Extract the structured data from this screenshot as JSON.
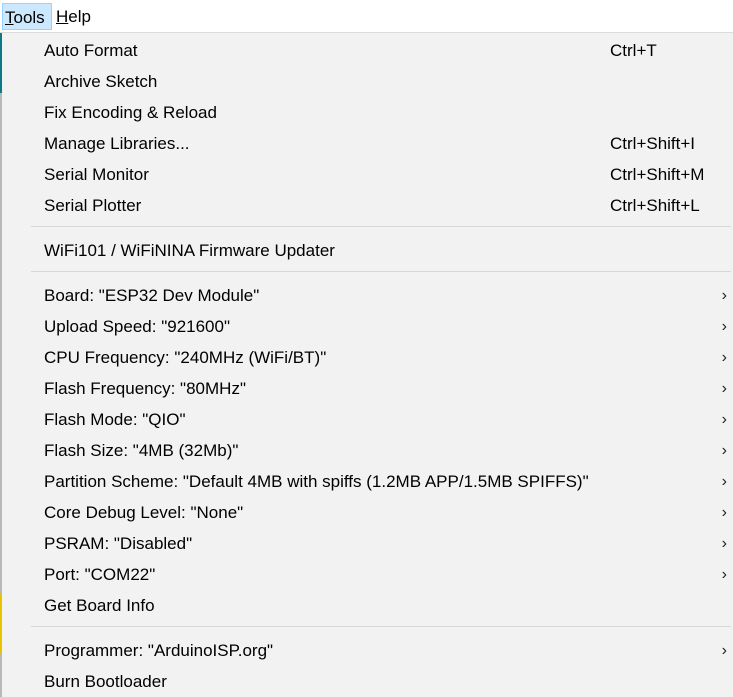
{
  "menubar": {
    "tools": {
      "mnemonic": "T",
      "rest": "ools"
    },
    "help": {
      "mnemonic": "H",
      "rest": "elp"
    }
  },
  "icons": {
    "submenu": "chevron-right-icon",
    "submenu_glyph": "›"
  },
  "tools_menu": {
    "auto_format": {
      "label": "Auto Format",
      "shortcut": "Ctrl+T"
    },
    "archive_sketch": {
      "label": "Archive Sketch"
    },
    "fix_encoding": {
      "label": "Fix Encoding & Reload"
    },
    "manage_libraries": {
      "label": "Manage Libraries...",
      "shortcut": "Ctrl+Shift+I"
    },
    "serial_monitor": {
      "label": "Serial Monitor",
      "shortcut": "Ctrl+Shift+M"
    },
    "serial_plotter": {
      "label": "Serial Plotter",
      "shortcut": "Ctrl+Shift+L"
    },
    "firmware_updater": {
      "label": "WiFi101 / WiFiNINA Firmware Updater"
    },
    "board": {
      "label": "Board: \"ESP32 Dev Module\""
    },
    "upload_speed": {
      "label": "Upload Speed: \"921600\""
    },
    "cpu_frequency": {
      "label": "CPU Frequency: \"240MHz (WiFi/BT)\""
    },
    "flash_frequency": {
      "label": "Flash Frequency: \"80MHz\""
    },
    "flash_mode": {
      "label": "Flash Mode: \"QIO\""
    },
    "flash_size": {
      "label": "Flash Size: \"4MB (32Mb)\""
    },
    "partition_scheme": {
      "label": "Partition Scheme: \"Default 4MB with spiffs (1.2MB APP/1.5MB SPIFFS)\""
    },
    "core_debug_level": {
      "label": "Core Debug Level: \"None\""
    },
    "psram": {
      "label": "PSRAM: \"Disabled\""
    },
    "port": {
      "label": "Port: \"COM22\""
    },
    "get_board_info": {
      "label": "Get Board Info"
    },
    "programmer": {
      "label": "Programmer: \"ArduinoISP.org\""
    },
    "burn_bootloader": {
      "label": "Burn Bootloader"
    }
  }
}
